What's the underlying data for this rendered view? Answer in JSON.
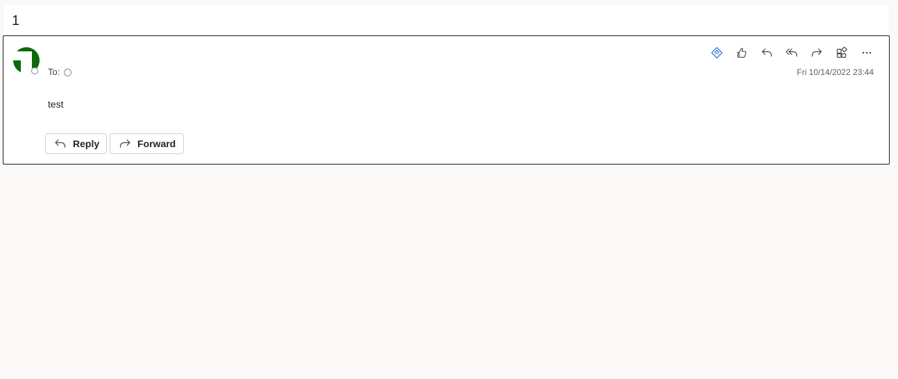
{
  "subject": {
    "text": "1"
  },
  "message": {
    "to_label": "To:",
    "timestamp": "Fri 10/14/2022 23:44",
    "body": "test",
    "avatar_color": "#0b6a0b",
    "toolbar": {
      "icons": [
        "loop-component-icon",
        "like-icon",
        "reply-icon",
        "reply-all-icon",
        "forward-icon",
        "apps-icon",
        "more-icon"
      ],
      "accent": "#2f7bd6"
    },
    "actions": {
      "reply_label": "Reply",
      "forward_label": "Forward"
    }
  }
}
